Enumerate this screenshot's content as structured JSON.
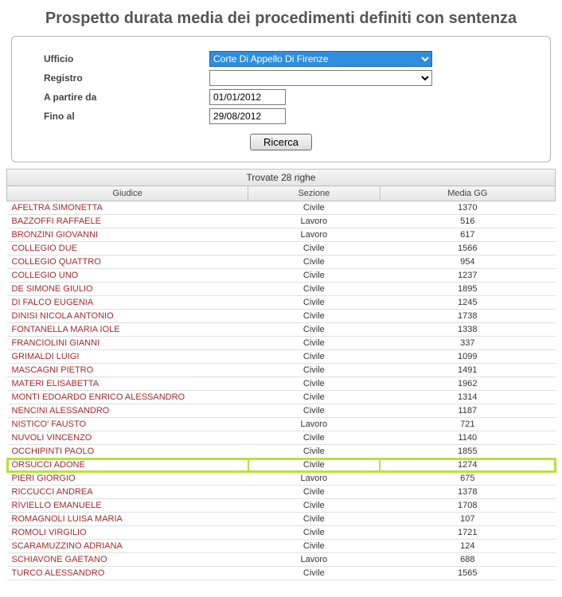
{
  "title": "Prospetto durata media dei procedimenti definiti con sentenza",
  "filters": {
    "ufficio_label": "Ufficio",
    "ufficio_value": "Corte Di Appello Di Firenze",
    "registro_label": "Registro",
    "registro_value": "",
    "from_label": "A partire da",
    "from_value": "01/01/2012",
    "to_label": "Fino al",
    "to_value": "29/08/2012",
    "search_label": "Ricerca"
  },
  "results": {
    "count_text": "Trovate 28 righe",
    "headers": {
      "giudice": "Giudice",
      "sezione": "Sezione",
      "media": "Media GG"
    },
    "rows": [
      {
        "giudice": "AFELTRA SIMONETTA",
        "sezione": "Civile",
        "media": "1370",
        "highlight": false
      },
      {
        "giudice": "BAZZOFFI RAFFAELE",
        "sezione": "Lavoro",
        "media": "516",
        "highlight": false
      },
      {
        "giudice": "BRONZINI GIOVANNI",
        "sezione": "Lavoro",
        "media": "617",
        "highlight": false
      },
      {
        "giudice": "COLLEGIO DUE",
        "sezione": "Civile",
        "media": "1566",
        "highlight": false
      },
      {
        "giudice": "COLLEGIO QUATTRO",
        "sezione": "Civile",
        "media": "954",
        "highlight": false
      },
      {
        "giudice": "COLLEGIO UNO",
        "sezione": "Civile",
        "media": "1237",
        "highlight": false
      },
      {
        "giudice": "DE SIMONE GIULIO",
        "sezione": "Civile",
        "media": "1895",
        "highlight": false
      },
      {
        "giudice": "DI FALCO EUGENIA",
        "sezione": "Civile",
        "media": "1245",
        "highlight": false
      },
      {
        "giudice": "DINISI NICOLA ANTONIO",
        "sezione": "Civile",
        "media": "1738",
        "highlight": false
      },
      {
        "giudice": "FONTANELLA MARIA IOLE",
        "sezione": "Civile",
        "media": "1338",
        "highlight": false
      },
      {
        "giudice": "FRANCIOLINI GIANNI",
        "sezione": "Civile",
        "media": "337",
        "highlight": false
      },
      {
        "giudice": "GRIMALDI LUIGI",
        "sezione": "Civile",
        "media": "1099",
        "highlight": false
      },
      {
        "giudice": "MASCAGNI PIETRO",
        "sezione": "Civile",
        "media": "1491",
        "highlight": false
      },
      {
        "giudice": "MATERI ELISABETTA",
        "sezione": "Civile",
        "media": "1962",
        "highlight": false
      },
      {
        "giudice": "MONTI EDOARDO ENRICO ALESSANDRO",
        "sezione": "Civile",
        "media": "1314",
        "highlight": false
      },
      {
        "giudice": "NENCINI ALESSANDRO",
        "sezione": "Civile",
        "media": "1187",
        "highlight": false
      },
      {
        "giudice": "NISTICO' FAUSTO",
        "sezione": "Lavoro",
        "media": "721",
        "highlight": false
      },
      {
        "giudice": "NUVOLI VINCENZO",
        "sezione": "Civile",
        "media": "1140",
        "highlight": false
      },
      {
        "giudice": "OCCHIPINTI PAOLO",
        "sezione": "Civile",
        "media": "1855",
        "highlight": false
      },
      {
        "giudice": "ORSUCCI ADONE",
        "sezione": "Civile",
        "media": "1274",
        "highlight": true
      },
      {
        "giudice": "PIERI GIORGIO",
        "sezione": "Lavoro",
        "media": "675",
        "highlight": false
      },
      {
        "giudice": "RICCUCCI ANDREA",
        "sezione": "Civile",
        "media": "1378",
        "highlight": false
      },
      {
        "giudice": "RIVIELLO EMANUELE",
        "sezione": "Civile",
        "media": "1708",
        "highlight": false
      },
      {
        "giudice": "ROMAGNOLI LUISA MARIA",
        "sezione": "Civile",
        "media": "107",
        "highlight": false
      },
      {
        "giudice": "ROMOLI VIRGILIO",
        "sezione": "Civile",
        "media": "1721",
        "highlight": false
      },
      {
        "giudice": "SCARAMUZZINO ADRIANA",
        "sezione": "Civile",
        "media": "124",
        "highlight": false
      },
      {
        "giudice": "SCHIAVONE GAETANO",
        "sezione": "Lavoro",
        "media": "688",
        "highlight": false
      },
      {
        "giudice": "TURCO ALESSANDRO",
        "sezione": "Civile",
        "media": "1565",
        "highlight": false
      }
    ]
  }
}
